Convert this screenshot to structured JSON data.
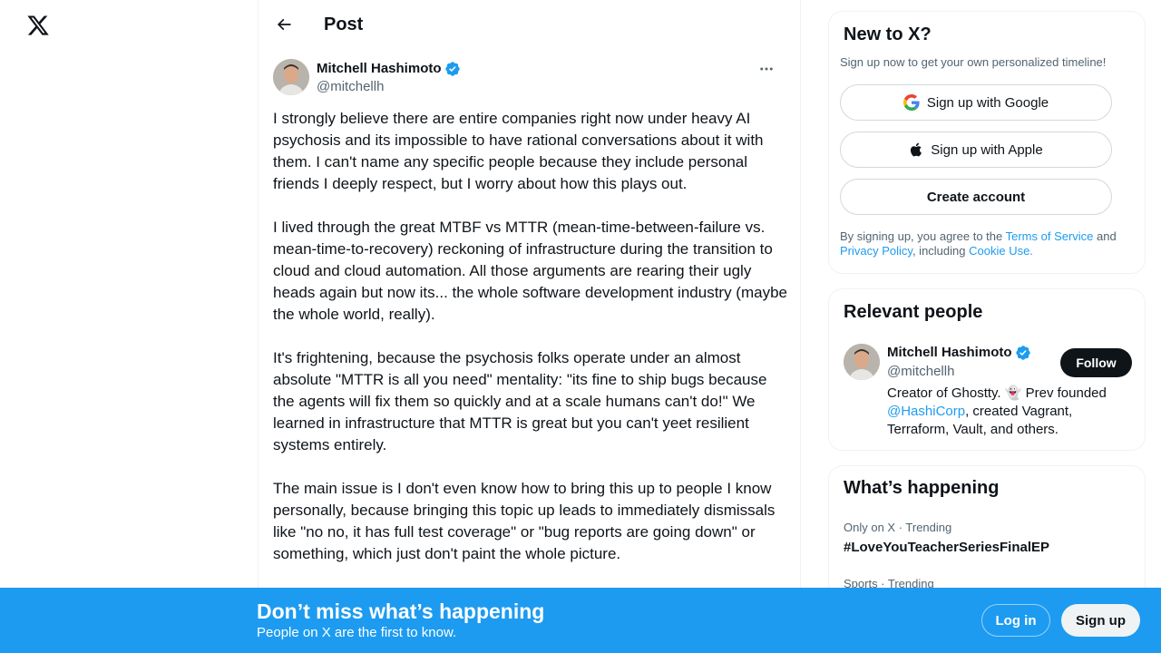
{
  "nav": {
    "logo_icon": "x-logo-icon"
  },
  "header": {
    "back_icon": "arrow-left-icon",
    "title": "Post"
  },
  "post": {
    "author_name": "Mitchell Hashimoto",
    "author_handle": "@mitchellh",
    "verified": true,
    "paragraphs": [
      "I strongly believe there are entire companies right now under heavy AI psychosis and its impossible to have rational conversations about it with them. I can't name any specific people because they include personal friends I deeply respect, but I worry about how this plays out.",
      "I lived through the great MTBF vs MTTR (mean-time-between-failure vs. mean-time-to-recovery) reckoning of infrastructure during the transition to cloud and cloud automation. All those arguments are rearing their ugly heads again but now its... the whole software development industry (maybe the whole world, really).",
      "It's frightening, because the psychosis folks operate under an almost absolute \"MTTR is all you need\" mentality: \"its fine to ship bugs because the agents will fix them so quickly and at a scale humans can't do!\" We learned in infrastructure that MTTR is great but you can't yeet resilient systems entirely.",
      "The main issue is I don't even know how to bring this up to people I know personally, because bringing this topic up leads to immediately dismissals like \"no no, it has full test coverage\" or \"bug reports are going down\" or something, which just don't paint the whole picture."
    ]
  },
  "signup_card": {
    "title": "New to X?",
    "subtitle": "Sign up now to get your own personalized timeline!",
    "google_label": "Sign up with Google",
    "apple_label": "Sign up with Apple",
    "create_label": "Create account",
    "terms_prefix": "By signing up, you agree to the ",
    "terms_link": "Terms of Service",
    "terms_and": " and",
    "privacy_link": "Privacy Policy",
    "terms_including": ", including ",
    "cookie_link": "Cookie Use."
  },
  "relevant_people": {
    "title": "Relevant people",
    "name": "Mitchell Hashimoto",
    "handle": "@mitchellh",
    "follow_label": "Follow",
    "bio_prefix": "Creator of Ghostty. 👻 Prev founded ",
    "bio_link": "@HashiCorp",
    "bio_suffix": ", created Vagrant, Terraform, Vault, and others."
  },
  "happening": {
    "title": "What’s happening",
    "trends": [
      {
        "meta": "Only on X · Trending",
        "name": "#LoveYouTeacherSeriesFinalEP"
      },
      {
        "meta": "Sports · Trending",
        "name": ""
      }
    ]
  },
  "banner": {
    "title": "Don’t miss what’s happening",
    "subtitle": "People on X are the first to know.",
    "login_label": "Log in",
    "signup_label": "Sign up"
  },
  "colors": {
    "accent": "#1d9bf0",
    "text": "#0f1419",
    "muted": "#536471",
    "border": "#eff3f4"
  }
}
